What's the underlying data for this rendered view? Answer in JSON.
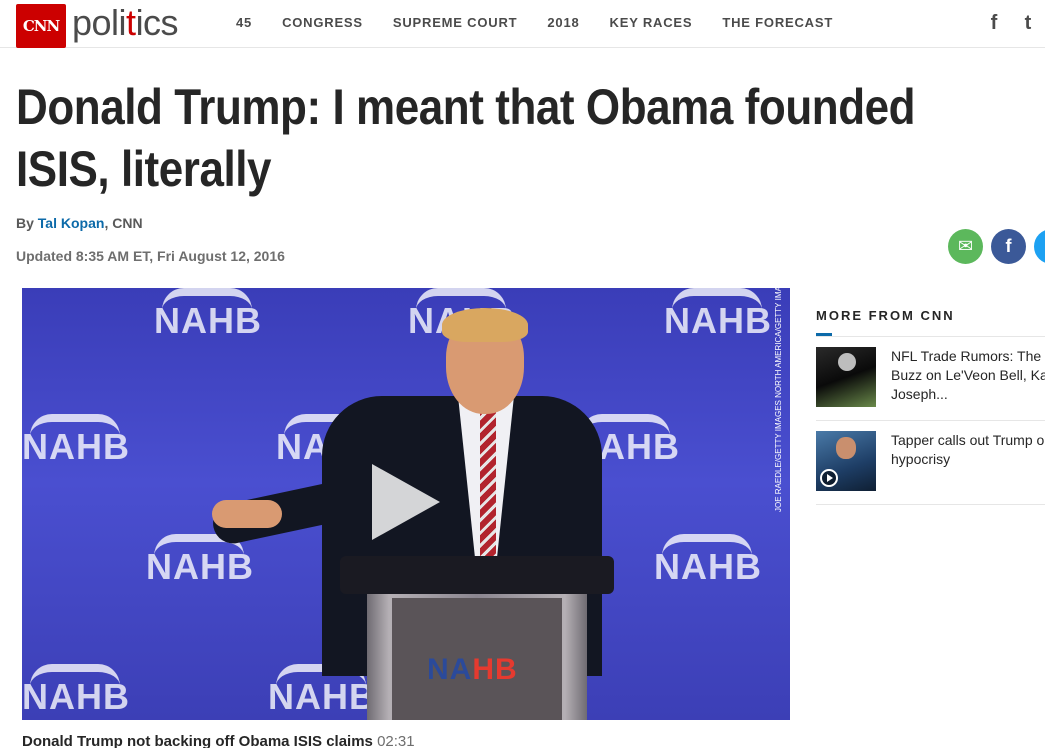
{
  "header": {
    "brand": "CNN",
    "section_prefix": "poli",
    "section_dot": "t",
    "section_suffix": "ics",
    "nav": [
      "45",
      "CONGRESS",
      "SUPREME COURT",
      "2018",
      "KEY RACES",
      "THE FORECAST"
    ],
    "social": [
      {
        "icon": "facebook-icon",
        "glyph": "f"
      },
      {
        "icon": "twitter-icon",
        "glyph": "t"
      }
    ]
  },
  "article": {
    "headline_line1": "Donald Trump: I meant that Obama founded",
    "headline_line2": "ISIS, literally",
    "byline_prefix": "By ",
    "author": "Tal Kopan",
    "byline_suffix": ", CNN",
    "updated": "Updated 8:35 AM ET, Fri August 12, 2016",
    "share": [
      {
        "icon": "email-icon",
        "glyph": "✉"
      },
      {
        "icon": "facebook-icon",
        "glyph": "f"
      },
      {
        "icon": "twitter-icon",
        "glyph": "t"
      }
    ]
  },
  "video": {
    "backdrop_text": "NAHB",
    "lectern_text_a": "NA",
    "lectern_text_b": "HB",
    "photo_credit": "JOE RAEDLE/GETTY IMAGES NORTH AMERICA/GETTY IMAGES",
    "caption": "Donald Trump not backing off Obama ISIS claims",
    "duration": "02:31"
  },
  "sidebar": {
    "title": "MORE FROM CNN",
    "items": [
      {
        "lines": [
          "NFL Trade Rumors: The L",
          "Buzz on Le'Veon Bell, Kar",
          "Joseph..."
        ],
        "is_video": false
      },
      {
        "lines": [
          "Tapper calls out Trump or",
          "hypocrisy"
        ],
        "is_video": true
      }
    ]
  },
  "colors": {
    "brand_red": "#cc0000",
    "link_blue": "#0c6aa9",
    "email_green": "#5cb85c",
    "facebook_blue": "#3b5998",
    "twitter_blue": "#1da1f2"
  }
}
